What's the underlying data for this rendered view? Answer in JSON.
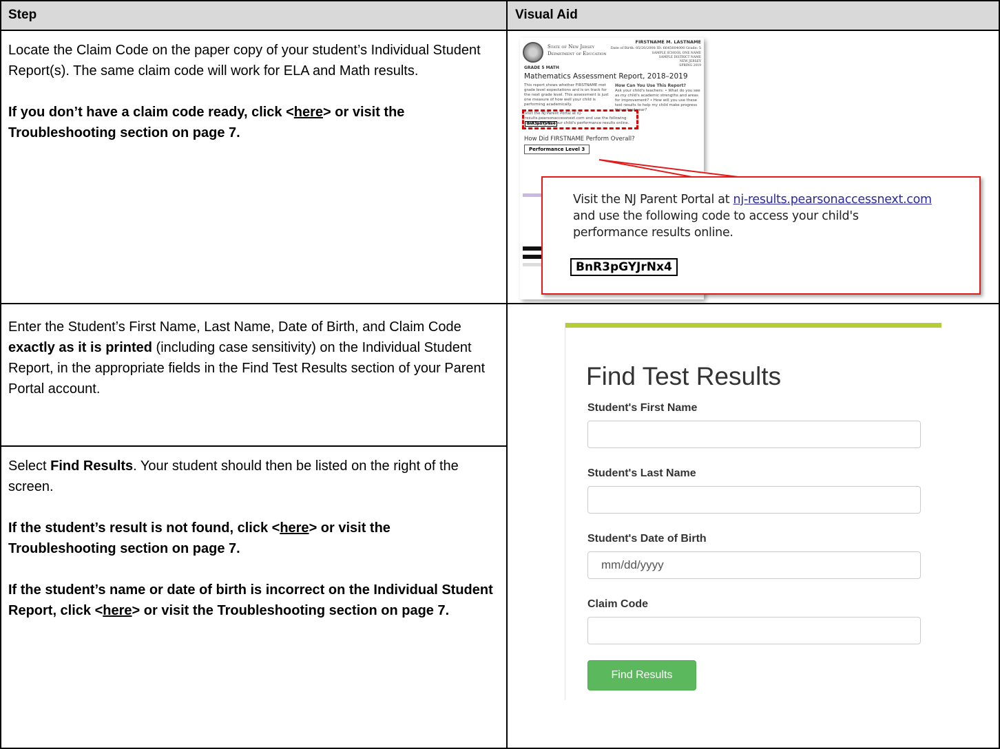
{
  "table": {
    "header_step": "Step",
    "header_visual": "Visual Aid"
  },
  "row1": {
    "text1": "Locate the Claim Code on the paper copy of your student’s Individual Student Report(s). The same claim code will work for ELA and Math results.",
    "bold_pre": "If you don’t have a claim code ready, click <",
    "bold_link": "here",
    "bold_post": "> or visit the Troubleshooting section on page 7."
  },
  "row2": {
    "pre": "Enter the Student’s First Name, Last Name, Date of Birth, and Claim Code ",
    "bold": "exactly as it is printed",
    "post": " (including case sensitivity) on the Individual Student Report, in the appropriate fields in the Find Test Results section of your Parent Portal account."
  },
  "row3": {
    "pre": "Select ",
    "bold": "Find Results",
    "post": ". Your student should then be listed on the right of the screen.",
    "nf_pre": "If the student’s result is not found, click <",
    "nf_link": "here",
    "nf_post": "> or visit the Troubleshooting section on page 7.",
    "inc_pre": "If the student’s name or date of birth is incorrect on the Individual Student Report, click <",
    "inc_link": "here",
    "inc_post": "> or visit the Troubleshooting section on page 7."
  },
  "report": {
    "state_line1": "State of New Jersey",
    "state_line2": "Department of Education",
    "student_name": "FIRSTNAME M. LASTNAME",
    "dob_line": "Date of Birth: 05/20/2008  ID: 6645604000  Grade: 5",
    "school": "SAMPLE SCHOOL ONE NAME",
    "district": "SAMPLE DISTRICT NAME",
    "state": "NEW JERSEY",
    "season": "SPRING 2019",
    "grade_label": "GRADE 5 MATH",
    "title": "Mathematics Assessment Report, 2018–2019",
    "intro": "This report shows whether FIRSTNAME met grade level expectations and is on track for the next grade level. This assessment is just one measure of how well your child is performing academically.",
    "visit_small": "Visit the NJ Parent Portal at nj-results.pearsonaccessnext.com and use the following code to access your child's performance results online.",
    "code_small": "BnR3pGYJrNx4",
    "how_heading": "How Can You Use This Report?",
    "how_body": "Ask your child's teachers: • What do you see as my child's academic strengths and areas for improvement? • How will you use these test results to help my child make progress this school year?",
    "perform_heading": "How Did FIRSTNAME Perform Overall?",
    "perf_level": "Performance Level 3"
  },
  "zoom": {
    "visit_pre": "Visit the NJ Parent Portal at ",
    "visit_link": "nj-results.pearsonaccessnext.com",
    "visit_post": "and use the following code to access your child's performance results online.",
    "code": "BnR3pGYJrNx4"
  },
  "form": {
    "title": "Find Test Results",
    "first_label": "Student's First Name",
    "last_label": "Student's Last Name",
    "dob_label": "Student's Date of Birth",
    "dob_placeholder": "mm/dd/yyyy",
    "claim_label": "Claim Code",
    "button": "Find Results",
    "accent_color": "#b6cd39",
    "button_color": "#5cb85c"
  }
}
